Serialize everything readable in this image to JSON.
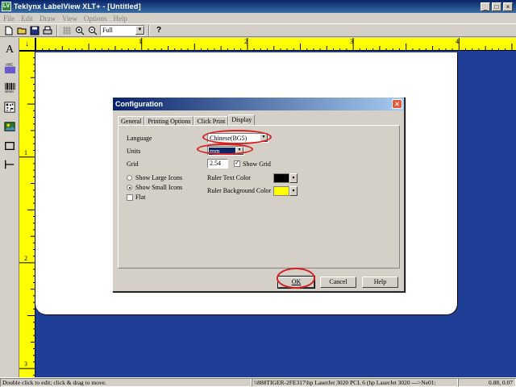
{
  "window": {
    "title": "Teklynx LabelView XLT+  - [Untitled]"
  },
  "menu": [
    "File",
    "Edit",
    "Draw",
    "View",
    "Options",
    "Help"
  ],
  "toolbar": {
    "icons": [
      "new-file-icon",
      "open-folder-icon",
      "save-icon",
      "print-icon",
      "grid-icon",
      "zoom-in-icon",
      "zoom-out-icon",
      "help-icon"
    ],
    "zoom_value": "Full"
  },
  "palette": [
    "text-tool-icon",
    "image-text-tool-icon",
    "barcode-tool-icon",
    "matrix-barcode-tool-icon",
    "picture-tool-icon",
    "rectangle-tool-icon",
    "line-tool-icon"
  ],
  "ruler": {
    "corner_icon": "down-arrow",
    "h_numbers": [
      "1",
      "2",
      "3",
      "4"
    ],
    "v_numbers": [
      "1",
      "2",
      "3"
    ]
  },
  "dialog": {
    "title": "Configuration",
    "tabs": [
      "General",
      "Printing Options",
      "Click Print",
      "Display"
    ],
    "active_tab": "Display",
    "language_label": "Language",
    "language_value": "Chinese(BG5)",
    "units_label": "Units",
    "units_value": "mm",
    "grid_label": "Grid",
    "grid_value": "2.54",
    "show_grid_label": "Show Grid",
    "show_grid_checked": true,
    "radio_large": "Show Large Icons",
    "radio_small": "Show Small Icons",
    "small_selected": true,
    "flat_label": "Flat",
    "flat_checked": false,
    "ruler_text_color_label": "Ruler Text Color",
    "ruler_text_color": "#000000",
    "ruler_bg_color_label": "Ruler Background Color",
    "ruler_bg_color": "#ffff00",
    "ok": "OK",
    "cancel": "Cancel",
    "help": "Help"
  },
  "status": {
    "hint": "Double click to edit; click & drag to move.",
    "printer": "\\\\888TIGER-2FE317\\hp LaserJet 3020 PCL 6 (hp LaserJet 3020 --->Ne01:",
    "coords": "0.88, 0.07"
  },
  "colors": {
    "canvas": "#1f3f97",
    "ruler": "#ffff00",
    "annotation": "#d42222"
  }
}
